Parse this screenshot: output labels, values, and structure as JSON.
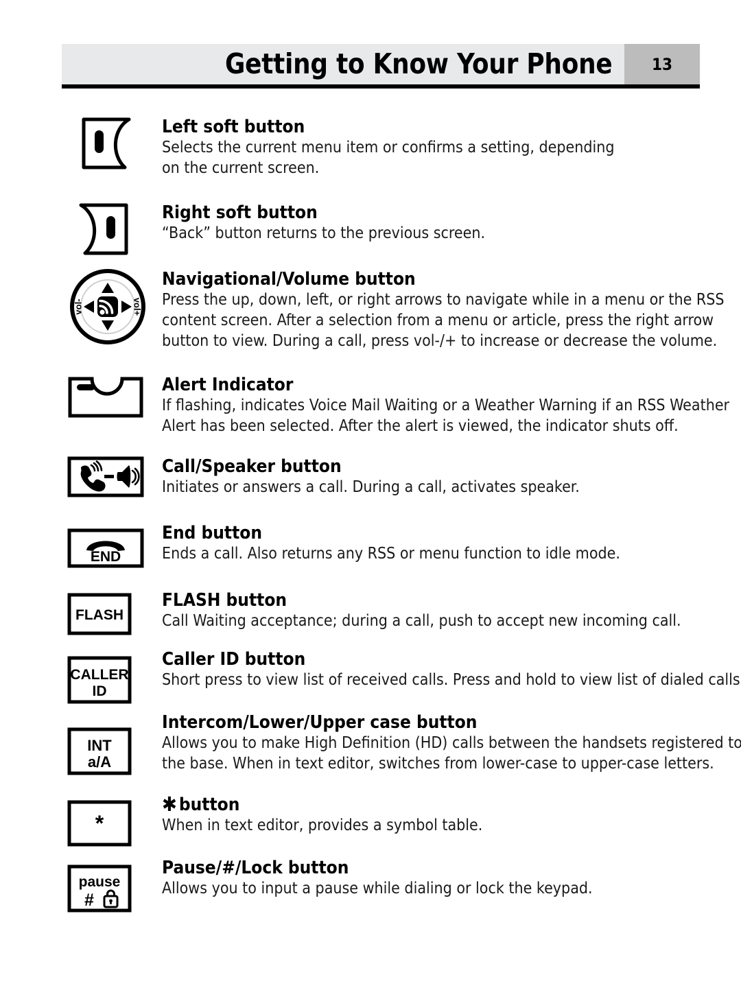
{
  "header": {
    "title": "Getting to Know Your Phone",
    "page_number": "13",
    "bar_color": "#e8e9ea",
    "page_block_color": "#bcbcbc",
    "rule_color": "#000000"
  },
  "entries": [
    {
      "id": "left-soft-button",
      "icon": "left-soft-button-icon",
      "title": "Left soft button",
      "desc": [
        "Selects the current menu item or confirms a setting, depending",
        "on the current screen."
      ]
    },
    {
      "id": "right-soft-button",
      "icon": "right-soft-button-icon",
      "title": "Right soft button",
      "desc": [
        "“Back” button returns to the previous screen."
      ]
    },
    {
      "id": "navigational-volume-button",
      "icon": "navigation-dpad-icon",
      "icon_labels": {
        "left": "vol-",
        "right": "vol+",
        "center": "rss-icon"
      },
      "title": "Navigational/Volume button",
      "desc": [
        "Press the up, down, left, or right arrows to navigate while in a menu or the RSS",
        "content screen. After a selection from a menu or article, press the right arrow",
        "button to view. During a call, press vol-/+ to increase or decrease the volume."
      ]
    },
    {
      "id": "alert-indicator",
      "icon": "alert-indicator-icon",
      "title": "Alert Indicator",
      "desc": [
        "If flashing, indicates Voice Mail Waiting or a Weather Warning if an RSS Weather",
        "Alert has been selected. After the alert is viewed, the indicator shuts off."
      ]
    },
    {
      "id": "call-speaker-button",
      "icon": "call-speaker-icon",
      "title": "Call/Speaker button",
      "desc": [
        "Initiates or answers a call. During a call, activates speaker."
      ]
    },
    {
      "id": "end-button",
      "icon": "end-handset-icon",
      "icon_label": "END",
      "title": "End button",
      "desc": [
        "Ends a call. Also returns any RSS or menu function to idle mode."
      ]
    },
    {
      "id": "flash-button",
      "icon": "flash-key-icon",
      "icon_label": "FLASH",
      "title": "FLASH button",
      "desc": [
        "Call Waiting acceptance; during a call, push to accept new incoming call."
      ]
    },
    {
      "id": "caller-id-button",
      "icon": "caller-id-key-icon",
      "icon_label_line1": "CALLER",
      "icon_label_line2": "ID",
      "title": "Caller ID button",
      "desc": [
        "Short press to view list of received calls. Press and hold to view list of dialed calls."
      ]
    },
    {
      "id": "intercom-case-button",
      "icon": "intercom-key-icon",
      "icon_label_line1": "INT",
      "icon_label_line2": "a/A",
      "title": "Intercom/Lower/Upper case button",
      "desc": [
        "Allows you to make High Definition (HD) calls between the handsets registered to",
        "the base. When in text editor, switches from lower-case to upper-case letters."
      ]
    },
    {
      "id": "star-button",
      "icon": "star-key-icon",
      "icon_label": "*",
      "title_glyph": "✱",
      "title": "button",
      "desc": [
        "When in text editor, provides a symbol table."
      ]
    },
    {
      "id": "pause-hash-lock-button",
      "icon": "pause-hash-lock-key-icon",
      "icon_label_line1": "pause",
      "icon_label_line2": "#",
      "icon_label_lock": "lock-icon",
      "title": "Pause/#/Lock button",
      "desc": [
        "Allows you to input a pause while dialing or lock the keypad."
      ]
    }
  ]
}
